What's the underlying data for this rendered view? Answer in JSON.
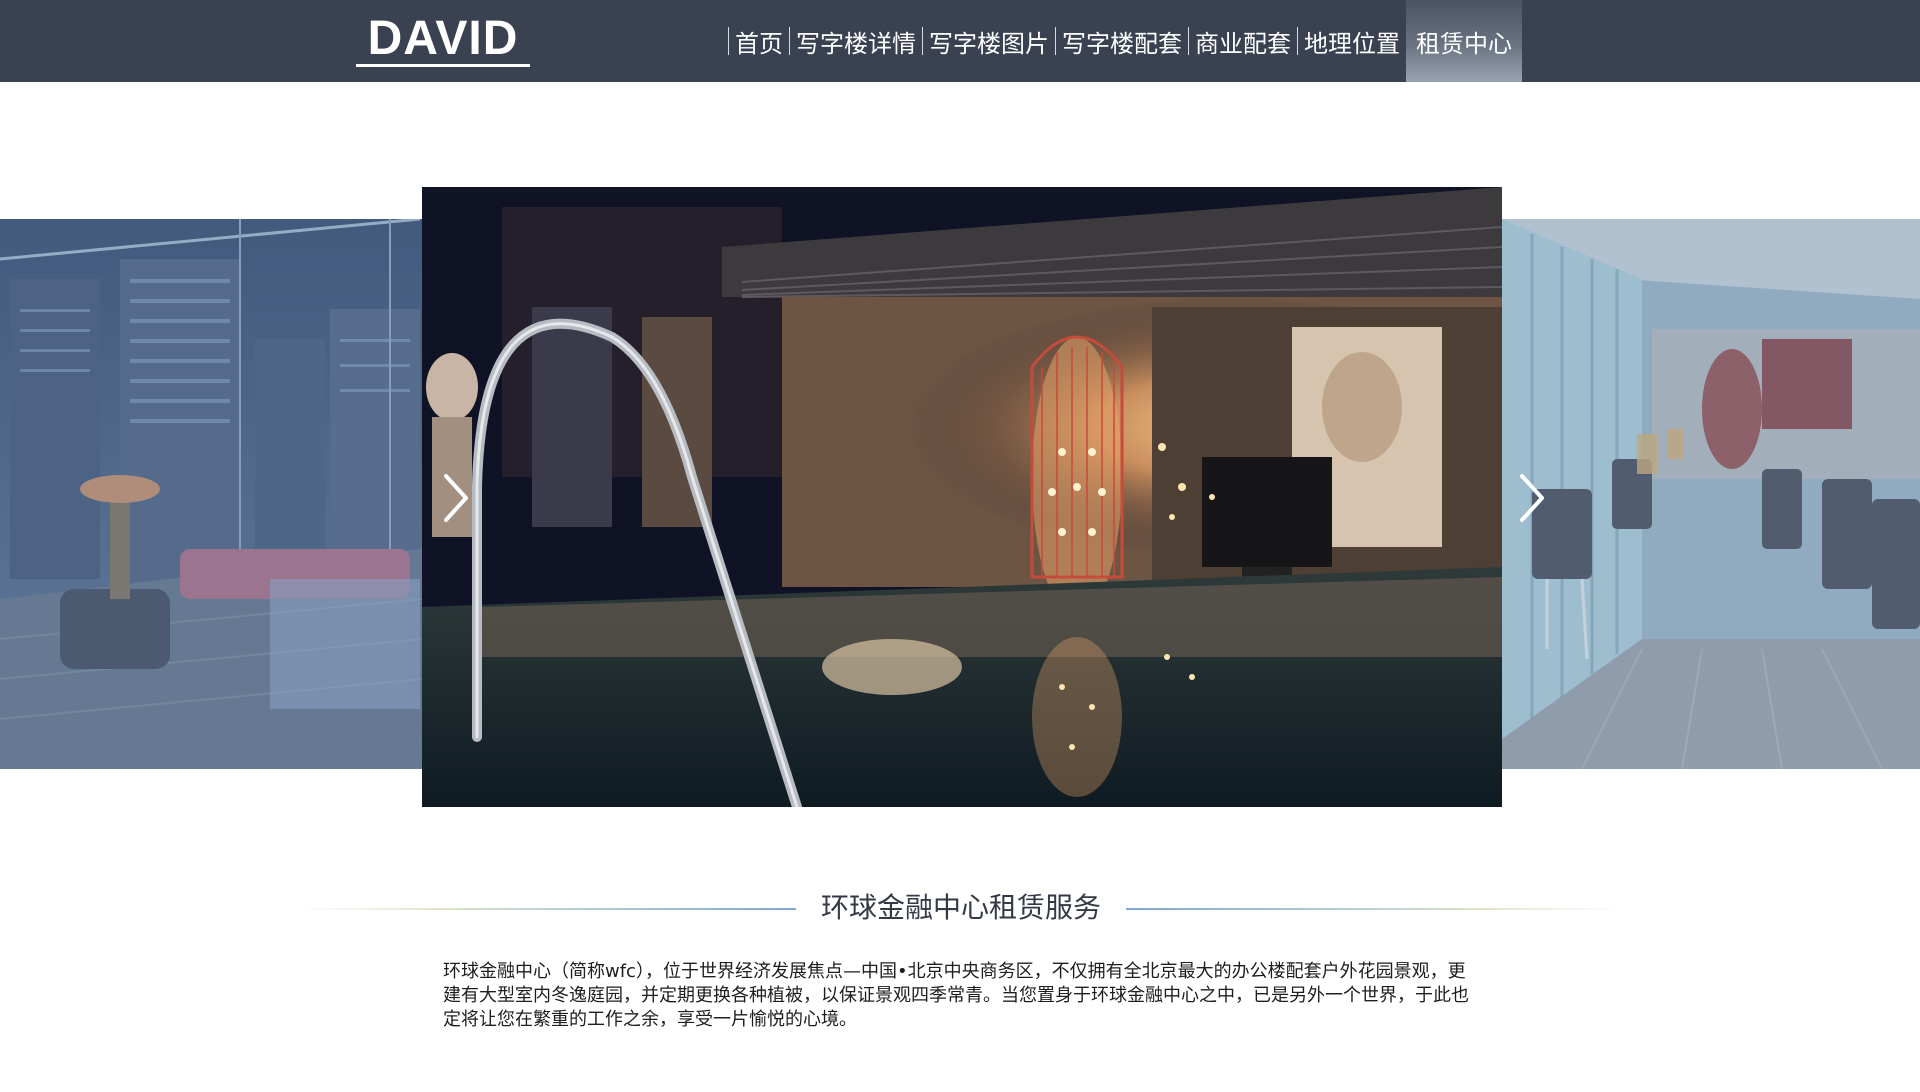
{
  "header": {
    "logo": "DAVID",
    "nav": [
      {
        "label": "首页",
        "active": false
      },
      {
        "label": "写字楼详情",
        "active": false
      },
      {
        "label": "写字楼图片",
        "active": false
      },
      {
        "label": "写字楼配套",
        "active": false
      },
      {
        "label": "商业配套",
        "active": false
      },
      {
        "label": "地理位置",
        "active": false
      },
      {
        "label": "租赁中心",
        "active": true
      }
    ]
  },
  "carousel": {
    "prev_icon": "chevron-left-icon",
    "next_icon": "chevron-right-icon"
  },
  "section": {
    "title": "环球金融中心租赁服务",
    "body": "环球金融中心（简称wfc），位于世界经济发展焦点—中国•北京中央商务区，不仅拥有全北京最大的办公楼配套户外花园景观，更建有大型室内冬逸庭园，并定期更换各种植被，以保证景观四季常青。当您置身于环球金融中心之中，已是另外一个世界，于此也定将让您在繁重的工作之余，享受一片愉悦的心境。"
  },
  "colors": {
    "header_bg": "#3a4150",
    "accent_line": "#7fa7d6"
  }
}
